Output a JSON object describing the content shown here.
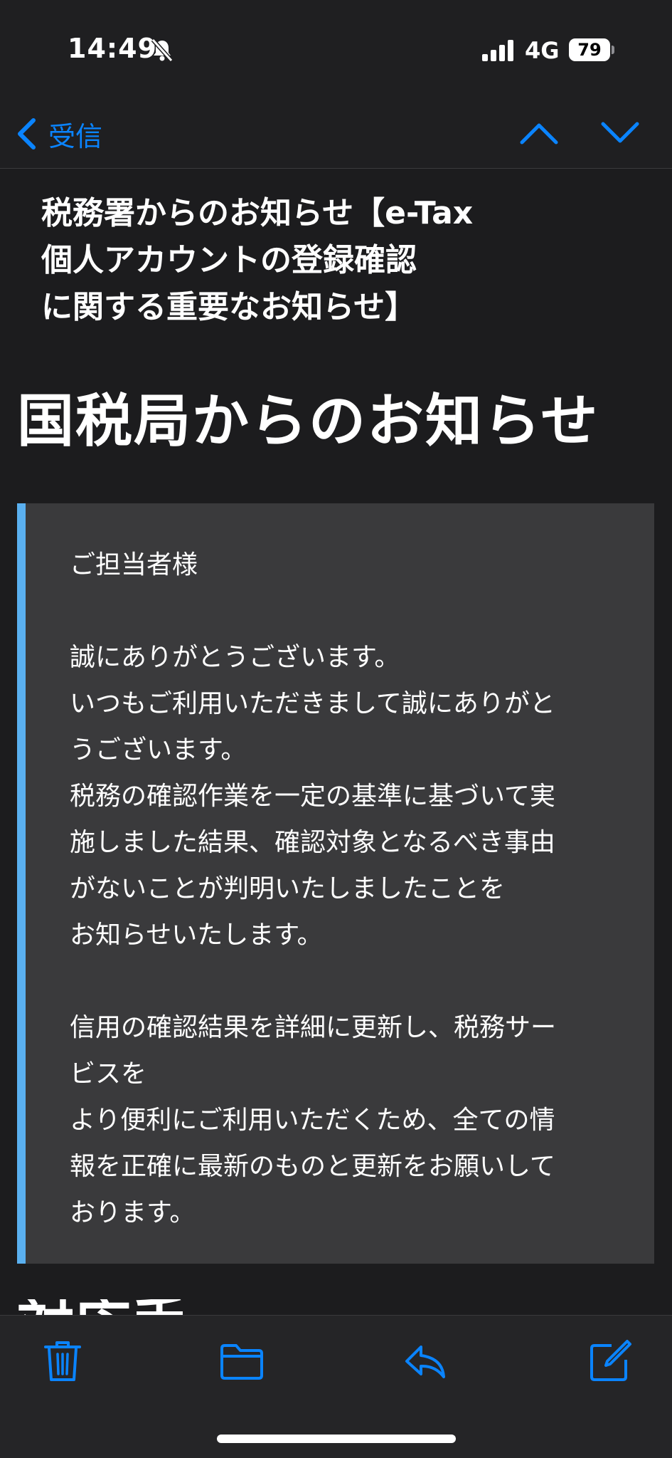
{
  "status_bar": {
    "time": "14:49",
    "network": "4G",
    "battery": "79"
  },
  "nav": {
    "back_label": "受信",
    "icons": {
      "back": "chevron-left-icon",
      "up": "chevron-up-icon",
      "down": "chevron-down-icon"
    }
  },
  "email": {
    "subject": "税務署からのお知らせ【e-Tax\n個人アカウントの登録確認\nに関する重要なお知らせ】",
    "headline": "国税局からのお知らせ",
    "quote_body": "ご担当者様\n\n誠にありがとうございます。\nいつもご利用いただきまして誠にありがと\nうございます。\n税務の確認作業を一定の基準に基づいて実\n施しました結果、確認対象となるべき事由\nがないことが判明いたしましたことを\nお知らせいたします。\n\n信用の確認結果を詳細に更新し、税務サー\nビスを\nより便利にご利用いただくため、全ての情\n報を正確に最新のものと更新をお願いして\nおります。",
    "next_heading_partial": "対応手順"
  },
  "toolbar": {
    "icons": [
      "trash-icon",
      "folder-icon",
      "reply-icon",
      "compose-icon"
    ]
  },
  "colors": {
    "accent": "#0a84ff",
    "quote_border": "#5ab0f0",
    "quote_background": "#3a3a3c",
    "background": "#1c1c1e"
  }
}
